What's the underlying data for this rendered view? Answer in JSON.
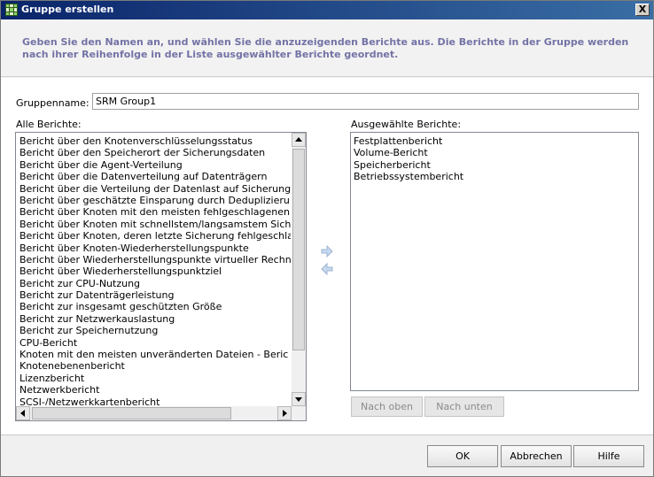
{
  "window": {
    "title": "Gruppe erstellen",
    "close_glyph": "X"
  },
  "banner": {
    "text": "Geben Sie den Namen an, und wählen Sie die anzuzeigenden Berichte aus. Die Berichte in der Gruppe werden nach ihrer Reihenfolge in der Liste ausgewählter Berichte geordnet."
  },
  "group_name": {
    "label": "Gruppenname:",
    "value": "SRM Group1"
  },
  "all_reports": {
    "label": "Alle Berichte:",
    "items": [
      "Bericht über den Knotenverschlüsselungsstatus",
      "Bericht über den Speicherort der Sicherungsdaten",
      "Bericht über die Agent-Verteilung",
      "Bericht über die Datenverteilung auf Datenträgern",
      "Bericht über die Verteilung der Datenlast auf Sicherung",
      "Bericht über geschätzte Einsparung durch Deduplizieru",
      "Bericht über Knoten mit den meisten fehlgeschlagenen",
      "Bericht über Knoten mit schnellstem/langsamstem Sich",
      "Bericht über Knoten, deren letzte Sicherung fehlgeschla",
      "Bericht über Knoten-Wiederherstellungspunkte",
      "Bericht über Wiederherstellungspunkte virtueller Rechn",
      "Bericht über Wiederherstellungspunktziel",
      "Bericht zur CPU-Nutzung",
      "Bericht zur Datenträgerleistung",
      "Bericht zur insgesamt geschützten Größe",
      "Bericht zur Netzwerkauslastung",
      "Bericht zur Speichernutzung",
      "CPU-Bericht",
      "Knoten mit den meisten unveränderten Dateien - Beric",
      "Knotenebenenbericht",
      "Lizenzbericht",
      "Netzwerkbericht",
      "SCSI-/Netzwerkkartenbericht"
    ]
  },
  "selected_reports": {
    "label": "Ausgewählte Berichte:",
    "items": [
      "Festplattenbericht",
      "Volume-Bericht",
      "Speicherbericht",
      "Betriebssystembericht"
    ]
  },
  "order_buttons": {
    "up": "Nach oben",
    "down": "Nach unten"
  },
  "footer": {
    "ok": "OK",
    "cancel": "Abbrechen",
    "help": "Hilfe"
  },
  "icons": {
    "title": "grid-icon",
    "add": "arrow-right-icon",
    "remove": "arrow-left-icon"
  },
  "colors": {
    "banner_text": "#7373a6",
    "title_bar": "#0a246a"
  }
}
